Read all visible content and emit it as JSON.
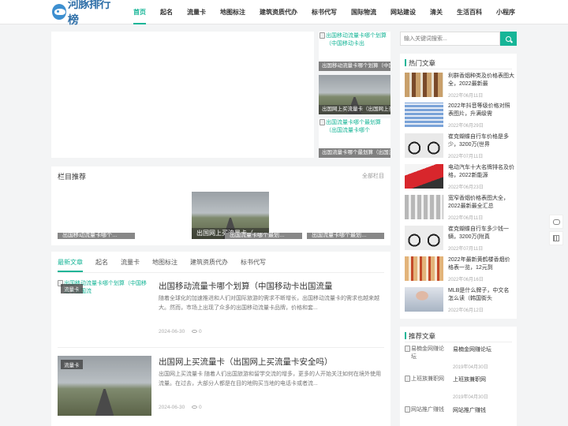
{
  "header": {
    "logo_text": "河豚排行榜",
    "nav": [
      "首页",
      "起名",
      "流量卡",
      "地图标注",
      "建筑资质代办",
      "标书代写",
      "国际物流",
      "网站建设",
      "清关",
      "生活百科",
      "小程序"
    ]
  },
  "slider_thumbs": [
    {
      "alt": "出国移动流量卡哪个划算（中国移动卡出",
      "caption": "出国移动流量卡哪个划算（中国移"
    },
    {
      "alt": "",
      "caption": "出国网上买流量卡（出国网上买"
    },
    {
      "alt": "出国流量卡哪个最划算（出国流量卡哪个",
      "caption": "出国流量卡哪个最划算（出国流量"
    }
  ],
  "recommend": {
    "title": "栏目推荐",
    "more": "全部栏目",
    "big_caption": "出国网上买流量卡（…",
    "small_captions": [
      "出国移动流量卡哪个…",
      "出国流量卡哪个最划…",
      "出国流量卡哪个最划…"
    ]
  },
  "news": {
    "tabs": [
      "最新文章",
      "起名",
      "流量卡",
      "地图标注",
      "建筑资质代办",
      "标书代写"
    ],
    "articles": [
      {
        "thumb_alt": "出国移动流量卡哪个划算（中国移动卡出国流",
        "badge": "流量卡",
        "title": "出国移动流量卡哪个划算（中国移动卡出国流量",
        "desc": "随着全球化的加速推进和人们对国际旅游的需求不断增长，出国移动流量卡的需求也越来越大。然而，市场上出现了众多的出国移动流量卡品牌，价格和套...",
        "date": "2024-06-30",
        "views": "0"
      },
      {
        "thumb_alt": "",
        "badge": "流量卡",
        "title": "出国网上买流量卡（出国网上买流量卡安全吗）",
        "desc": "出国网上买流量卡 随着人们出国旅游和留学交流的增多，更多的人开始关注如何在境外使用流量。在过去，大部分人都是在目的地购买当地的电话卡或者流...",
        "date": "2024-06-30",
        "views": "0"
      }
    ]
  },
  "search": {
    "placeholder": "输入关键词搜索..."
  },
  "hot": {
    "title": "热门文章",
    "items": [
      {
        "title": "利群香烟种类及价格表图大全，2022最新最",
        "date": "2022年06月11日"
      },
      {
        "title": "2022年抖音等级价格对照表图片，升满级需",
        "date": "2022年06月29日"
      },
      {
        "title": "崔克蝴蝶自行车价格是多少，3200万(世界",
        "date": "2022年07月11日"
      },
      {
        "title": "电动汽车十大名牌排名及价格，2022新能源",
        "date": "2022年06月23日"
      },
      {
        "title": "宽窄香烟价格表图大全，2022最新最全汇总",
        "date": "2022年06月11日"
      },
      {
        "title": "崔克蝴蝶自行车多少钱一辆，3200万(附真",
        "date": "2022年07月11日"
      },
      {
        "title": "2022年最新黄鹤楼香烟价格表一览，12元到",
        "date": "2022年06月16日"
      },
      {
        "title": "MLB是什么牌子，中文名怎么读（韩国街头",
        "date": "2022年06月12日"
      }
    ]
  },
  "recomm": {
    "title": "推荐文章",
    "items": [
      {
        "alt": "易楠金网赚论坛",
        "title": "易楠金网赚论坛",
        "date": "2019年04月30日"
      },
      {
        "alt": "上班族兼职网",
        "title": "上班族兼职网",
        "date": "2019年04月30日"
      },
      {
        "alt": "网站推广赚钱",
        "title": "网站推广赚钱",
        "date": ""
      }
    ]
  }
}
